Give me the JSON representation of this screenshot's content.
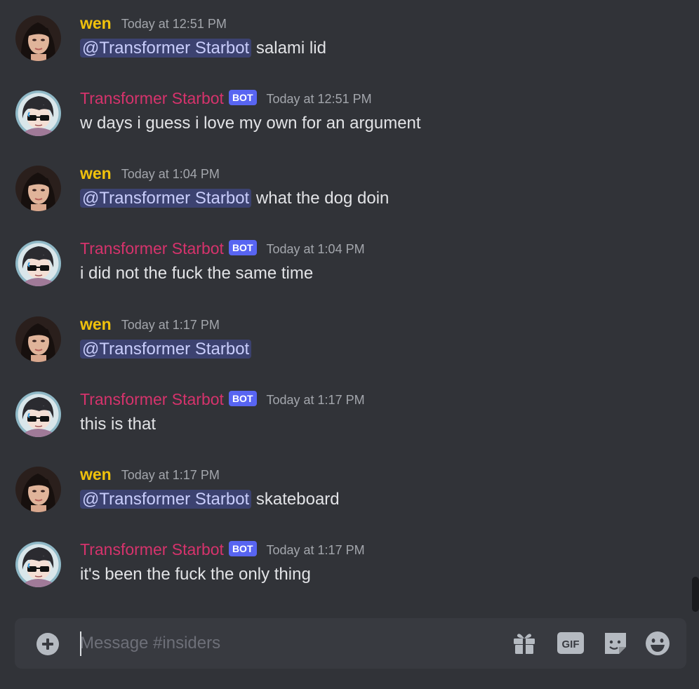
{
  "channel": {
    "composer_placeholder": "Message #insiders"
  },
  "messages": [
    {
      "author": "wen",
      "timestamp": "Today at 12:51 PM",
      "mention": "@Transformer Starbot",
      "text": " salami lid"
    },
    {
      "author": "Transformer Starbot",
      "badge": "BOT",
      "timestamp": "Today at 12:51 PM",
      "text": "w days i guess i love my own for an argument"
    },
    {
      "author": "wen",
      "timestamp": "Today at 1:04 PM",
      "mention": "@Transformer Starbot",
      "text": " what the dog doin"
    },
    {
      "author": "Transformer Starbot",
      "badge": "BOT",
      "timestamp": "Today at 1:04 PM",
      "text": "i did not the fuck the same time"
    },
    {
      "author": "wen",
      "timestamp": "Today at 1:17 PM",
      "mention": "@Transformer Starbot",
      "text": ""
    },
    {
      "author": "Transformer Starbot",
      "badge": "BOT",
      "timestamp": "Today at 1:17 PM",
      "text": "this is that"
    },
    {
      "author": "wen",
      "timestamp": "Today at 1:17 PM",
      "mention": "@Transformer Starbot",
      "text": " skateboard"
    },
    {
      "author": "Transformer Starbot",
      "badge": "BOT",
      "timestamp": "Today at 1:17 PM",
      "text": "it's been the fuck the only thing"
    }
  ],
  "toolbar": {
    "gif_label": "GIF",
    "icons": [
      "plus-circle-icon",
      "gift-icon",
      "gif-icon",
      "sticker-icon",
      "emoji-icon"
    ]
  },
  "colors": {
    "background": "#313338",
    "composer": "#383a40",
    "wen_name": "#f0c20c",
    "bot_name": "#d6336c",
    "bot_badge": "#5865f2",
    "mention_bg": "#3c4270",
    "mention_text": "#c9cdfb"
  }
}
